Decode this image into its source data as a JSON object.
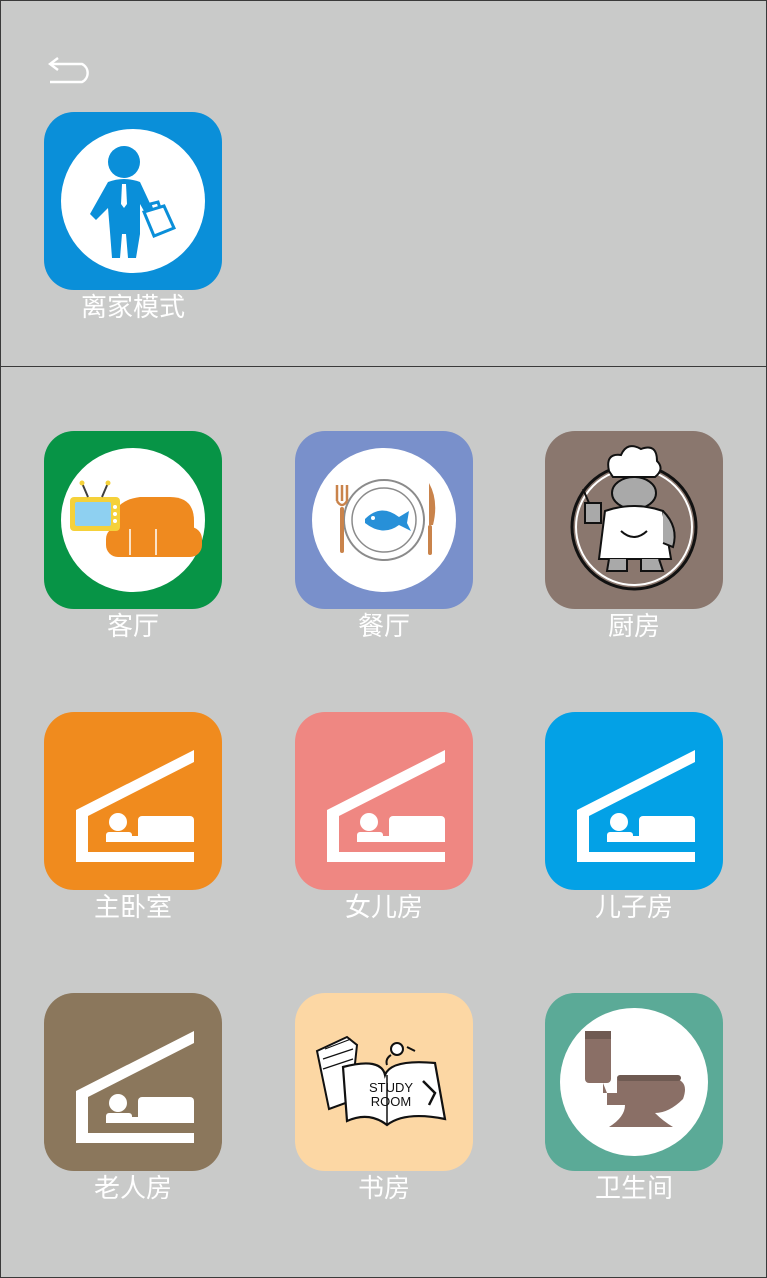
{
  "header": {
    "back_icon": "back-arrow-icon"
  },
  "mode": {
    "label": "离家模式",
    "icon": "businessman-leaving-icon",
    "color": "#0a8fd9"
  },
  "rooms": [
    {
      "label": "客厅",
      "icon": "sofa-tv-icon",
      "color": "#079446"
    },
    {
      "label": "餐厅",
      "icon": "plate-fish-icon",
      "color": "#7990cb"
    },
    {
      "label": "厨房",
      "icon": "chef-icon",
      "color": "#8a776e"
    },
    {
      "label": "主卧室",
      "icon": "bed-house-icon",
      "color": "#f08b1e"
    },
    {
      "label": "女儿房",
      "icon": "bed-house-icon",
      "color": "#ef8782"
    },
    {
      "label": "儿子房",
      "icon": "bed-house-icon",
      "color": "#03a1e6"
    },
    {
      "label": "老人房",
      "icon": "bed-house-icon",
      "color": "#8b775c"
    },
    {
      "label": "书房",
      "icon": "study-room-book-icon",
      "color": "#fcd7a4",
      "book_text": "STUDY ROOM"
    },
    {
      "label": "卫生间",
      "icon": "toilet-icon",
      "color": "#5baa97"
    }
  ]
}
